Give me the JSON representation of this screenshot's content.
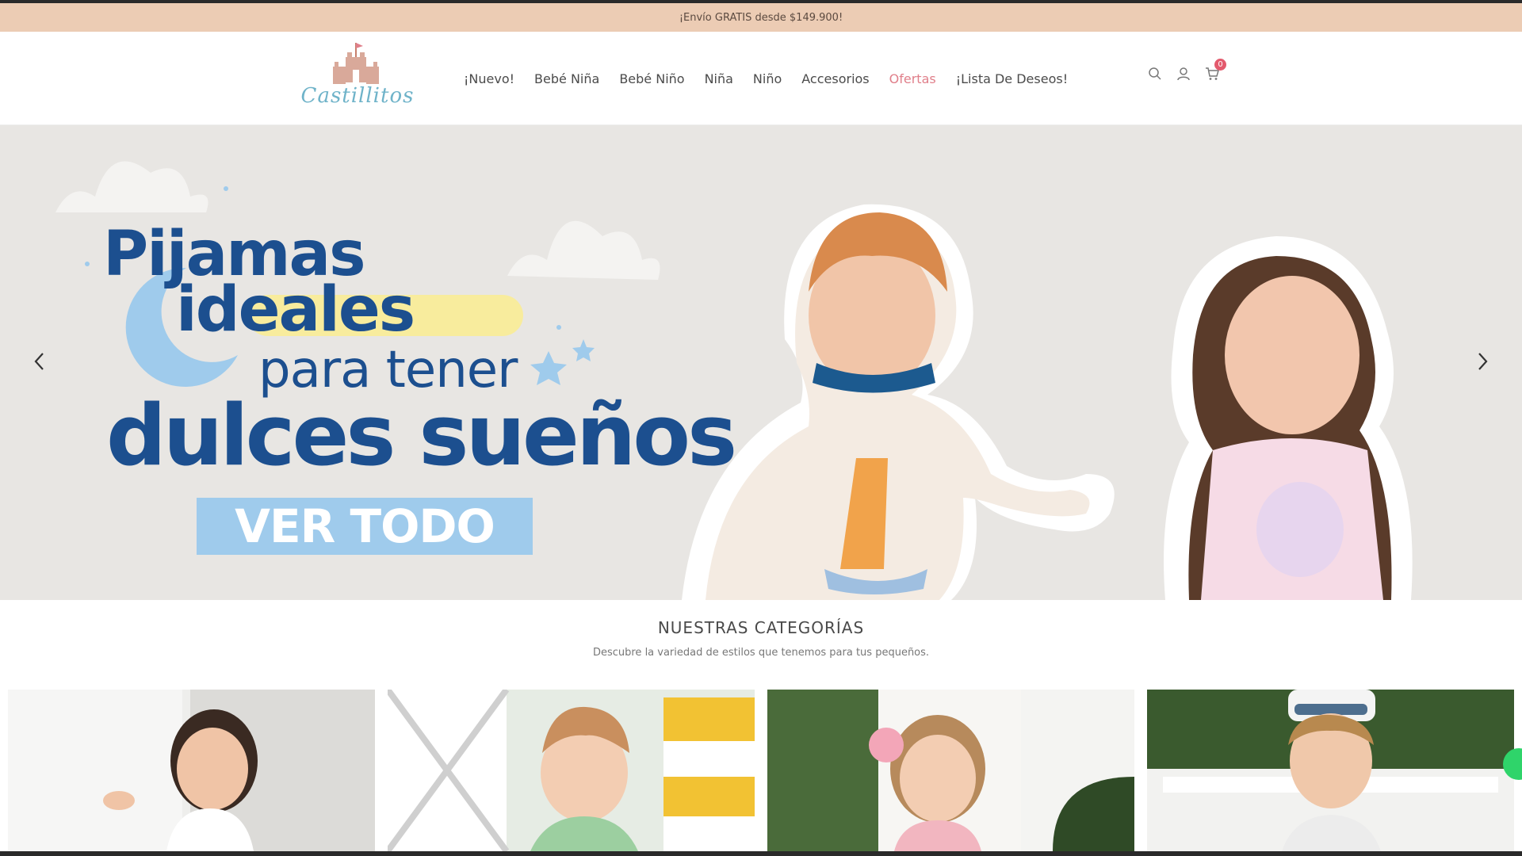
{
  "promo_bar": {
    "text": "¡Envío GRATIS desde $149.900!"
  },
  "header": {
    "logo_text": "Castillitos",
    "nav": [
      {
        "label": "¡Nuevo!",
        "highlight": false
      },
      {
        "label": "Bebé Niña",
        "highlight": false
      },
      {
        "label": "Bebé Niño",
        "highlight": false
      },
      {
        "label": "Niña",
        "highlight": false
      },
      {
        "label": "Niño",
        "highlight": false
      },
      {
        "label": "Accesorios",
        "highlight": false
      },
      {
        "label": "Ofertas",
        "highlight": true
      },
      {
        "label": "¡Lista De Deseos!",
        "highlight": false
      }
    ],
    "icons": [
      "search-icon",
      "user-icon",
      "cart-icon"
    ],
    "cart_count": "0"
  },
  "hero": {
    "line1": "Pijamas",
    "line2": "ideales",
    "line3": "para tener",
    "line4": "dulces sueños",
    "cta": "VER TODO"
  },
  "categories": {
    "title": "NUESTRAS CATEGORÍAS",
    "subtitle": "Descubre la variedad de estilos que tenemos para tus pequeños."
  },
  "colors": {
    "promo_bg": "#ecccb4",
    "brand_blue": "#1c4f8f",
    "cta_bg": "#9fcbec",
    "sale": "#e07f8a",
    "badge": "#e35a6d"
  }
}
